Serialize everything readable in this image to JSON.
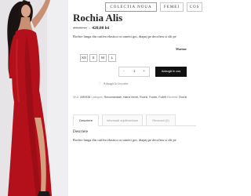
{
  "nav": {
    "items": [
      "COLECTIA NOUA",
      "FEMEI",
      "COS"
    ]
  },
  "product": {
    "title": "Rochia Alis",
    "price_old": "455,00 lei",
    "price_sep": "»",
    "price_new": "420,00 lei",
    "short_description": "Rochie lunga din catifea elastica cu umerii goi, drapaj pe decolteu si slit pe",
    "size_label": "Marime",
    "sizes": [
      "XS",
      "S",
      "M",
      "L"
    ],
    "quantity": "1",
    "qty_minus": "-",
    "qty_plus": "+",
    "add_to_cart": "Adaugă în coș",
    "wishlist": "Adaugă la favorite"
  },
  "meta": {
    "sku_label": "SKU:",
    "sku": "AR0938",
    "category_label": "Categorii:",
    "categories": "Recomandate, Haine femei, Rochii, Footer, Fulleft",
    "tag_label": "Etichetă:",
    "tag": "Rochii"
  },
  "tabs": {
    "items": [
      "Descriere",
      "Informații suplimentare",
      "Recenzii (0)"
    ]
  },
  "description": {
    "heading": "Descriere",
    "body": "Rochie lunga din catifea elastica cu umerii goi, drapaj pe decolteu si slit pe"
  },
  "colors": {
    "dress": "#b3101b",
    "accent": "#111111"
  }
}
